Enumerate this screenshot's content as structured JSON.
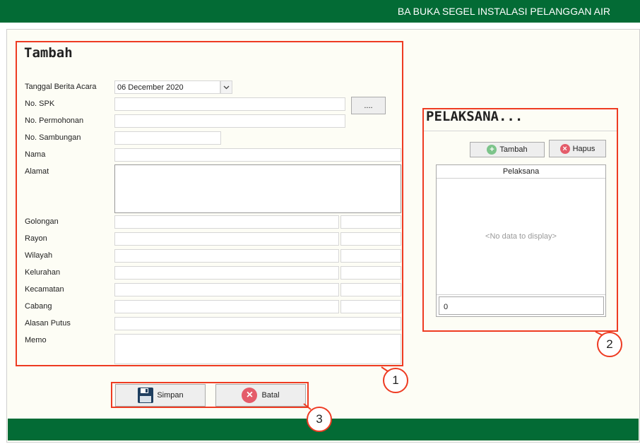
{
  "header": {
    "title": "BA BUKA SEGEL INSTALASI PELANGGAN AIR"
  },
  "form": {
    "heading": "Tambah",
    "labels": {
      "tanggal": "Tanggal Berita Acara",
      "spk": "No. SPK",
      "permohonan": "No. Permohonan",
      "sambungan": "No. Sambungan",
      "nama": "Nama",
      "alamat": "Alamat",
      "golongan": "Golongan",
      "rayon": "Rayon",
      "wilayah": "Wilayah",
      "kelurahan": "Kelurahan",
      "kecamatan": "Kecamatan",
      "cabang": "Cabang",
      "alasan": "Alasan Putus",
      "memo": "Memo"
    },
    "tanggal_value": "06 December 2020",
    "lookup_button": "...."
  },
  "pelaksana": {
    "heading": "PELAKSANA...",
    "add_button": "Tambah",
    "delete_button": "Hapus",
    "column": "Pelaksana",
    "empty_text": "<No data to display>",
    "footer_value": "0"
  },
  "actions": {
    "save": "Simpan",
    "cancel": "Batal"
  },
  "callouts": {
    "one": "1",
    "two": "2",
    "three": "3"
  },
  "colors": {
    "brand_green": "#036b35",
    "highlight": "#ee3b22"
  }
}
